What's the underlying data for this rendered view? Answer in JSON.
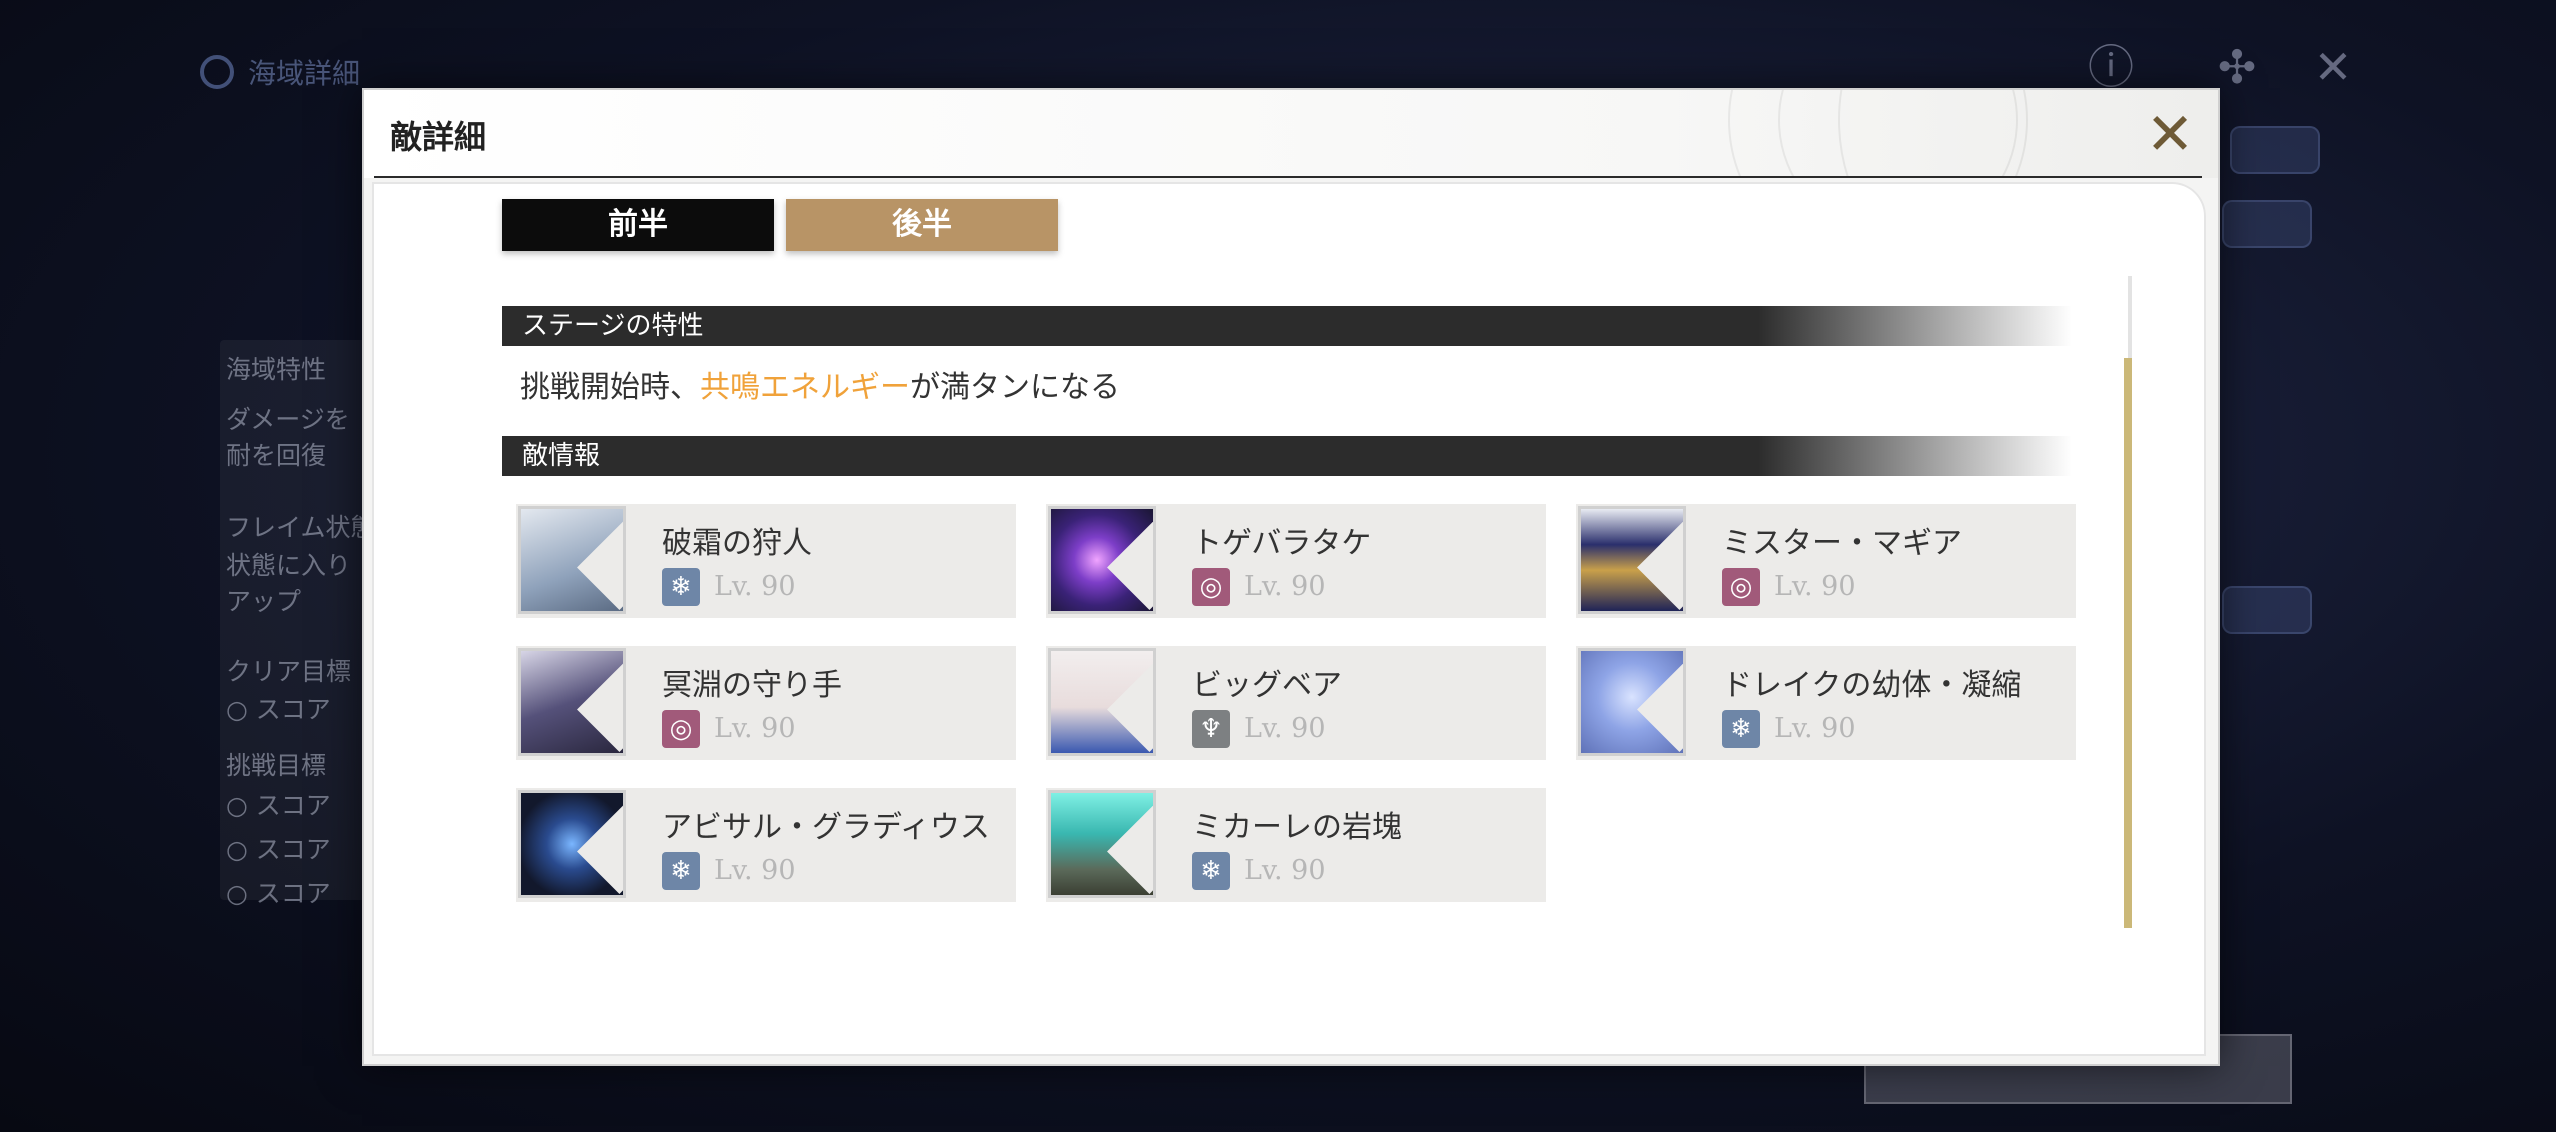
{
  "background": {
    "header_title": "海域詳細",
    "side_lines": [
      "海域特性",
      "ダメージを",
      "耐を回復",
      "フレイム状態",
      "状態に入り",
      "アップ",
      "クリア目標",
      "○ スコア",
      "挑戦目標",
      "○ スコア",
      "○ スコア",
      "○ スコア"
    ]
  },
  "modal": {
    "title": "敵詳細",
    "tabs": [
      {
        "label": "前半",
        "active": true
      },
      {
        "label": "後半",
        "active": false
      }
    ],
    "stage_section_label": "ステージの特性",
    "trait": {
      "prefix": "挑戦開始時、",
      "highlight": "共鳴エネルギー",
      "suffix": "が満タンになる",
      "highlight_color": "#f0a23a"
    },
    "enemy_section_label": "敵情報",
    "enemies": [
      {
        "name": "破霜の狩人",
        "element": "glacio",
        "icon": "snowflake-icon",
        "level": "Lv. 90"
      },
      {
        "name": "トゲバラタケ",
        "element": "havoc",
        "icon": "spiral-icon",
        "level": "Lv. 90"
      },
      {
        "name": "ミスター・マギア",
        "element": "havoc",
        "icon": "spiral-icon",
        "level": "Lv. 90"
      },
      {
        "name": "冥淵の守り手",
        "element": "havoc",
        "icon": "spiral-icon",
        "level": "Lv. 90"
      },
      {
        "name": "ビッグベア",
        "element": "aero",
        "icon": "aero-icon",
        "level": "Lv. 90"
      },
      {
        "name": "ドレイクの幼体・凝縮",
        "element": "glacio",
        "icon": "snowflake-icon",
        "level": "Lv. 90"
      },
      {
        "name": "アビサル・グラディウス",
        "element": "glacio",
        "icon": "snowflake-icon",
        "level": "Lv. 90"
      },
      {
        "name": "ミカーレの岩塊",
        "element": "glacio",
        "icon": "snowflake-icon",
        "level": "Lv. 90"
      }
    ]
  },
  "colors": {
    "accent_gold": "#b89466",
    "tab_active": "#0c0c0c",
    "glacio": "#6e86a7",
    "havoc": "#a15a7a",
    "aero": "#7d8082"
  }
}
